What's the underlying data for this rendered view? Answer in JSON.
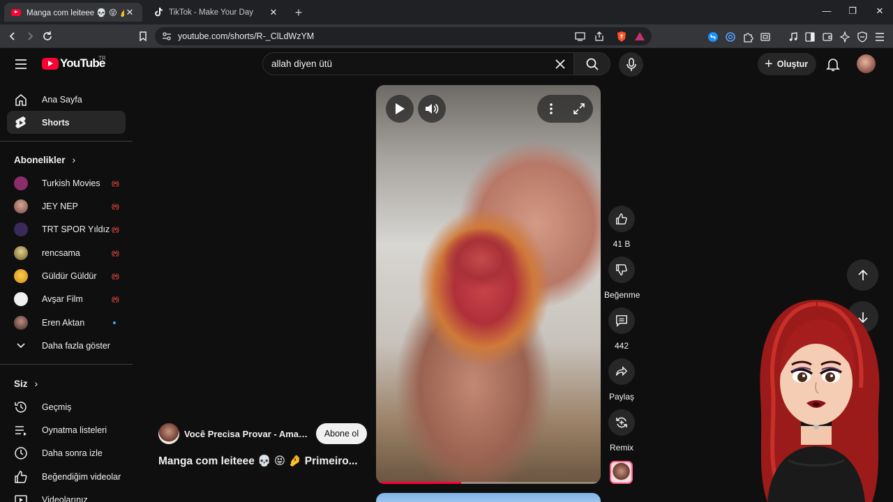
{
  "browser": {
    "tabs": [
      {
        "title": "Manga com leiteee 💀 😝 🤌 Pri",
        "active": true
      },
      {
        "title": "TikTok - Make Your Day",
        "active": false
      }
    ],
    "url": "youtube.com/shorts/R-_ClLdWzYM"
  },
  "header": {
    "logo_text": "YouTube",
    "country_code": "TR",
    "search_value": "allah diyen ütü",
    "create_label": "Oluştur"
  },
  "sidebar": {
    "main": [
      {
        "label": "Ana Sayfa"
      },
      {
        "label": "Shorts"
      }
    ],
    "subscriptions_title": "Abonelikler",
    "subscriptions": [
      {
        "label": "Turkish Movies",
        "color": "#8b2c6b"
      },
      {
        "label": "JEY NEP",
        "color": "#b07a6a"
      },
      {
        "label": "TRT SPOR Yıldız",
        "color": "#3a2a5a"
      },
      {
        "label": "rencsama",
        "color": "#9a8a3a"
      },
      {
        "label": "Güldür Güldür",
        "color": "#e0a020"
      },
      {
        "label": "Avşar Film",
        "color": "#f1f1f1"
      },
      {
        "label": "Eren Aktan",
        "color": "#5a3a3a"
      }
    ],
    "show_more": "Daha fazla göster",
    "you_title": "Siz",
    "you": [
      {
        "label": "Geçmiş"
      },
      {
        "label": "Oynatma listeleri"
      },
      {
        "label": "Daha sonra izle"
      },
      {
        "label": "Beğendiğim videolar"
      },
      {
        "label": "Videolarınız"
      }
    ]
  },
  "short": {
    "channel_name": "Você Precisa Provar - Amanda Ramalho",
    "subscribe_label": "Abone ol",
    "title": "Manga com leiteee 💀 😝 🤌 Primeiro...",
    "progress": 0.36,
    "actions": {
      "like_count": "41 B",
      "dislike_label": "Beğenme",
      "comment_count": "442",
      "share_label": "Paylaş",
      "remix_label": "Remix"
    }
  },
  "colors": {
    "accent": "#ff0033",
    "background": "#0f0f0f",
    "surface": "#272727",
    "live": "#ff4e45"
  }
}
